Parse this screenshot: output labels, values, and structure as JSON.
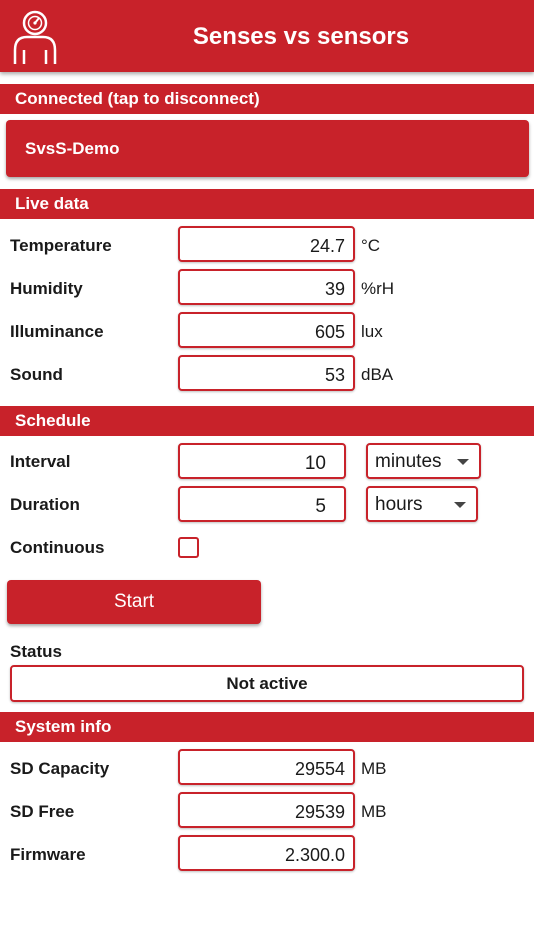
{
  "app": {
    "title": "Senses vs sensors",
    "logo_icon": "person-gauge-icon"
  },
  "connection": {
    "header": "Connected (tap to disconnect)",
    "device_name": "SvsS-Demo"
  },
  "live_data": {
    "header": "Live data",
    "rows": [
      {
        "label": "Temperature",
        "value": "24.7",
        "unit": "°C"
      },
      {
        "label": "Humidity",
        "value": "39",
        "unit": "%rH"
      },
      {
        "label": "Illuminance",
        "value": "605",
        "unit": "lux"
      },
      {
        "label": "Sound",
        "value": "53",
        "unit": "dBA"
      }
    ]
  },
  "schedule": {
    "header": "Schedule",
    "interval": {
      "label": "Interval",
      "value": "10",
      "unit": "minutes"
    },
    "duration": {
      "label": "Duration",
      "value": "5",
      "unit": "hours"
    },
    "continuous": {
      "label": "Continuous",
      "checked": false
    },
    "start_label": "Start",
    "status_label": "Status",
    "status_value": "Not active"
  },
  "system_info": {
    "header": "System info",
    "rows": [
      {
        "label": "SD Capacity",
        "value": "29554",
        "unit": "MB"
      },
      {
        "label": "SD Free",
        "value": "29539",
        "unit": "MB"
      },
      {
        "label": "Firmware",
        "value": "2.300.0",
        "unit": ""
      }
    ]
  },
  "colors": {
    "accent": "#c8222a",
    "text": "#1a1a1a",
    "background": "#ffffff"
  }
}
